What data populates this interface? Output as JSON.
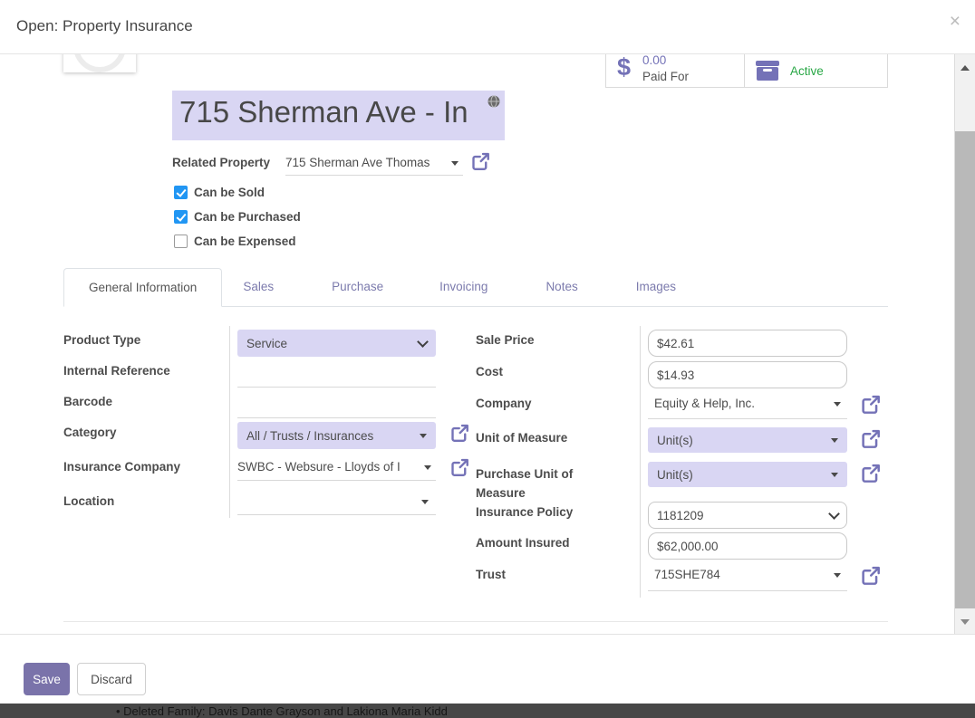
{
  "colors": {
    "accent_purple": "#7472b7",
    "tab_purple": "#7c7bad",
    "field_highlight": "#d9d6f3",
    "save_button": "#7a73aa",
    "active_green": "#28a745",
    "checkbox_blue": "#2196f3"
  },
  "header": {
    "title": "Open: Property Insurance",
    "close_icon": "×"
  },
  "stats": {
    "paid_for": {
      "icon_glyph": "$",
      "value": "0.00",
      "label": "Paid For"
    },
    "active": {
      "label": "Active"
    }
  },
  "product": {
    "name": "715 Sherman Ave - In",
    "related_property_label": "Related Property",
    "related_property_value": "715 Sherman Ave Thomas",
    "checkboxes": [
      {
        "label": "Can be Sold",
        "checked": true
      },
      {
        "label": "Can be Purchased",
        "checked": true
      },
      {
        "label": "Can be Expensed",
        "checked": false
      }
    ]
  },
  "tabs": [
    {
      "label": "General Information",
      "active": true
    },
    {
      "label": "Sales",
      "active": false
    },
    {
      "label": "Purchase",
      "active": false
    },
    {
      "label": "Invoicing",
      "active": false
    },
    {
      "label": "Notes",
      "active": false
    },
    {
      "label": "Images",
      "active": false
    }
  ],
  "form": {
    "product_type": {
      "label": "Product Type",
      "value": "Service"
    },
    "internal_reference": {
      "label": "Internal Reference",
      "value": ""
    },
    "barcode": {
      "label": "Barcode",
      "value": ""
    },
    "category": {
      "label": "Category",
      "value": "All / Trusts / Insurances"
    },
    "insurance_company": {
      "label": "Insurance Company",
      "value": "SWBC - Websure - Lloyds of I"
    },
    "location": {
      "label": "Location",
      "value": ""
    },
    "sale_price": {
      "label": "Sale Price",
      "value": "$42.61"
    },
    "cost": {
      "label": "Cost",
      "value": "$14.93"
    },
    "company": {
      "label": "Company",
      "value": "Equity & Help, Inc."
    },
    "unit_of_measure": {
      "label": "Unit of Measure",
      "value": "Unit(s)"
    },
    "purchase_unit_of_measure": {
      "label": "Purchase Unit of Measure",
      "value": "Unit(s)"
    },
    "insurance_policy": {
      "label": "Insurance Policy",
      "value": "1181209"
    },
    "amount_insured": {
      "label": "Amount Insured",
      "value": "$62,000.00"
    },
    "trust": {
      "label": "Trust",
      "value": "715SHE784"
    }
  },
  "footer": {
    "save": "Save",
    "discard": "Discard"
  },
  "backdrop": {
    "clipped_text": "• Deleted Family: Davis Dante Grayson and Lakiona Maria Kidd"
  }
}
